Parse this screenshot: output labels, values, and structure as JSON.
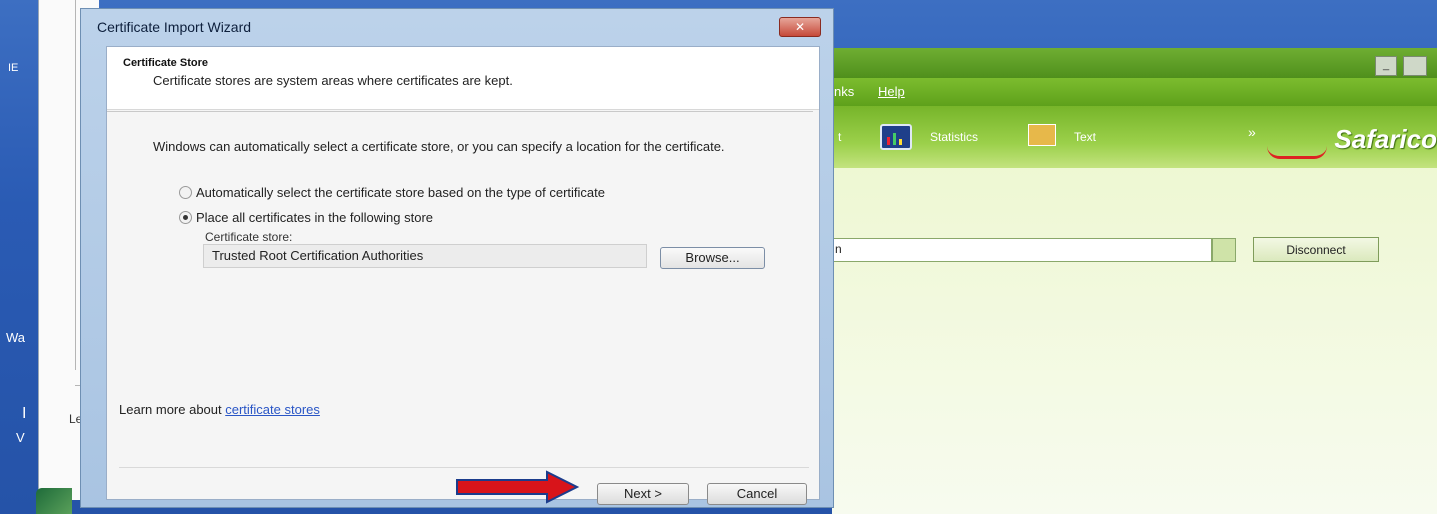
{
  "desktop": {
    "label_ie": "IE",
    "label_wa": "Wa",
    "label_i": "I",
    "label_v": "V"
  },
  "background_window": {
    "partial_text": "Le"
  },
  "app": {
    "brand": "Safarico",
    "menu_partial_1": "nks",
    "menu_help": "Help",
    "toolbar_partial": "t",
    "toolbar_statistics": "Statistics",
    "toolbar_text": "Text",
    "toolbar_more": "»",
    "connection_field_value": "n",
    "disconnect_label": "Disconnect",
    "minimize_glyph": "_"
  },
  "wizard": {
    "title": "Certificate Import Wizard",
    "close_glyph": "✕",
    "header_title": "Certificate Store",
    "header_subtitle": "Certificate stores are system areas where certificates are kept.",
    "intro": "Windows can automatically select a certificate store, or you can specify a location for the certificate.",
    "options": [
      {
        "label": "Automatically select the certificate store based on the type of certificate",
        "selected": false
      },
      {
        "label": "Place all certificates in the following store",
        "selected": true
      }
    ],
    "store_label": "Certificate store:",
    "store_value": "Trusted Root Certification Authorities",
    "browse_label": "Browse...",
    "learn_prefix": "Learn more about ",
    "learn_link": "certificate stores",
    "next_label": "Next >",
    "cancel_label": "Cancel"
  },
  "colors": {
    "annotation_arrow": "#d8141a",
    "arrow_outline": "#1b3c8c"
  }
}
